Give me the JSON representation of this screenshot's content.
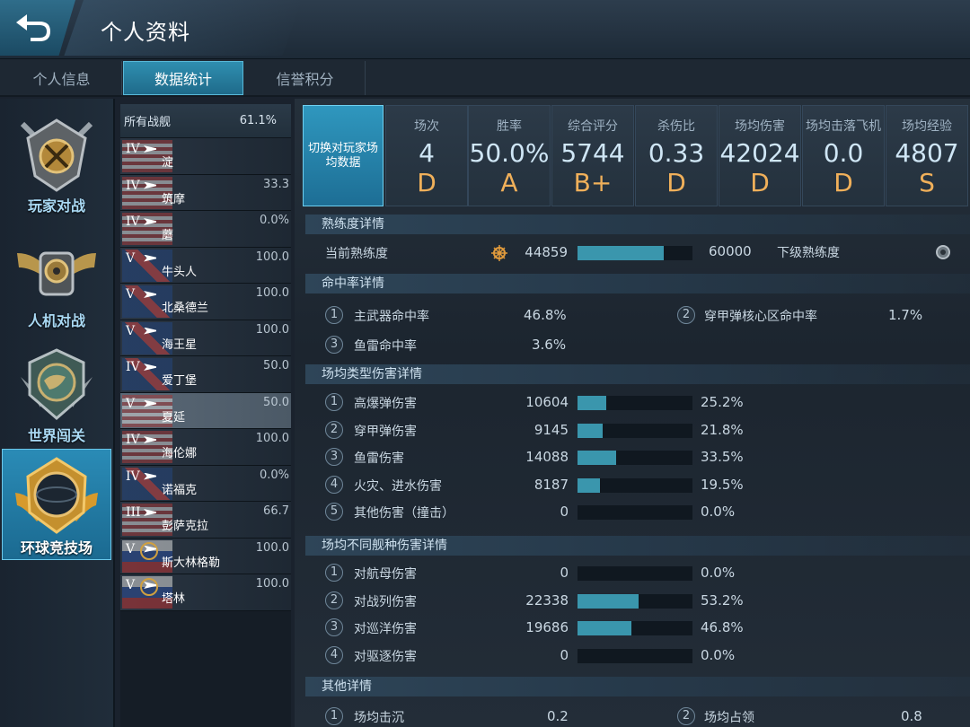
{
  "header": {
    "title": "个人资料"
  },
  "tabs": [
    {
      "label": "个人信息"
    },
    {
      "label": "数据统计"
    },
    {
      "label": "信誉积分"
    }
  ],
  "modes": [
    {
      "label": "玩家对战"
    },
    {
      "label": "人机对战"
    },
    {
      "label": "世界闯关"
    },
    {
      "label": "环球竞技场"
    }
  ],
  "shiplist": {
    "header_label": "所有战舰",
    "header_rate": "61.1%",
    "ships": [
      {
        "tier": "IV",
        "name": "淀",
        "rate": "",
        "flag": "us"
      },
      {
        "tier": "IV",
        "name": "筑摩",
        "rate": "33.3",
        "flag": "us"
      },
      {
        "tier": "IV",
        "name": "蘑",
        "rate": "0.0%",
        "flag": "us"
      },
      {
        "tier": "V",
        "name": "牛头人",
        "rate": "100.0",
        "flag": "uk"
      },
      {
        "tier": "V",
        "name": "北桑德兰",
        "rate": "100.0",
        "flag": "uk"
      },
      {
        "tier": "V",
        "name": "海王星",
        "rate": "100.0",
        "flag": "uk"
      },
      {
        "tier": "IV",
        "name": "爱丁堡",
        "rate": "50.0",
        "flag": "uk"
      },
      {
        "tier": "V",
        "name": "夏延",
        "rate": "50.0",
        "flag": "us"
      },
      {
        "tier": "IV",
        "name": "海伦娜",
        "rate": "100.0",
        "flag": "us"
      },
      {
        "tier": "IV",
        "name": "诺福克",
        "rate": "0.0%",
        "flag": "uk"
      },
      {
        "tier": "III",
        "name": "彭萨克拉",
        "rate": "66.7",
        "flag": "us"
      },
      {
        "tier": "V",
        "name": "斯大林格勒",
        "rate": "100.0",
        "flag": "ru"
      },
      {
        "tier": "V",
        "name": "塔林",
        "rate": "100.0",
        "flag": "ru"
      }
    ]
  },
  "switch_button": {
    "label": "切换对玩家场均数据"
  },
  "summary": [
    {
      "label": "场次",
      "value": "4",
      "grade": "D"
    },
    {
      "label": "胜率",
      "value": "50.0%",
      "grade": "A"
    },
    {
      "label": "综合评分",
      "value": "5744",
      "grade": "B+"
    },
    {
      "label": "杀伤比",
      "value": "0.33",
      "grade": "D"
    },
    {
      "label": "场均伤害",
      "value": "42024",
      "grade": "D"
    },
    {
      "label": "场均击落飞机",
      "value": "0.0",
      "grade": "D"
    },
    {
      "label": "场均经验",
      "value": "4807",
      "grade": "S"
    }
  ],
  "proficiency": {
    "title": "熟练度详情",
    "current_label": "当前熟练度",
    "current_value": "44859",
    "max_value": "60000",
    "fill": 0.748,
    "next_label": "下级熟练度"
  },
  "hit_rate": {
    "title": "命中率详情",
    "items": [
      {
        "num": "1",
        "label": "主武器命中率",
        "value": "46.8%"
      },
      {
        "num": "2",
        "label": "穿甲弹核心区命中率",
        "value": "1.7%"
      },
      {
        "num": "3",
        "label": "鱼雷命中率",
        "value": "3.6%"
      }
    ]
  },
  "damage_types": {
    "title": "场均类型伤害详情",
    "items": [
      {
        "num": "1",
        "label": "高爆弹伤害",
        "value": "10604",
        "pct": "25.2%",
        "fill": 0.252
      },
      {
        "num": "2",
        "label": "穿甲弹伤害",
        "value": "9145",
        "pct": "21.8%",
        "fill": 0.218
      },
      {
        "num": "3",
        "label": "鱼雷伤害",
        "value": "14088",
        "pct": "33.5%",
        "fill": 0.335
      },
      {
        "num": "4",
        "label": "火灾、进水伤害",
        "value": "8187",
        "pct": "19.5%",
        "fill": 0.195
      },
      {
        "num": "5",
        "label": "其他伤害（撞击）",
        "value": "0",
        "pct": "0.0%",
        "fill": 0
      }
    ]
  },
  "damage_ships": {
    "title": "场均不同舰种伤害详情",
    "items": [
      {
        "num": "1",
        "label": "对航母伤害",
        "value": "0",
        "pct": "0.0%",
        "fill": 0
      },
      {
        "num": "2",
        "label": "对战列伤害",
        "value": "22338",
        "pct": "53.2%",
        "fill": 0.532
      },
      {
        "num": "3",
        "label": "对巡洋伤害",
        "value": "19686",
        "pct": "46.8%",
        "fill": 0.468
      },
      {
        "num": "4",
        "label": "对驱逐伤害",
        "value": "0",
        "pct": "0.0%",
        "fill": 0
      }
    ]
  },
  "other": {
    "title": "其他详情",
    "items": [
      {
        "num": "1",
        "label": "场均击沉",
        "value": "0.2"
      },
      {
        "num": "2",
        "label": "场均占领",
        "value": "0.8"
      }
    ]
  }
}
